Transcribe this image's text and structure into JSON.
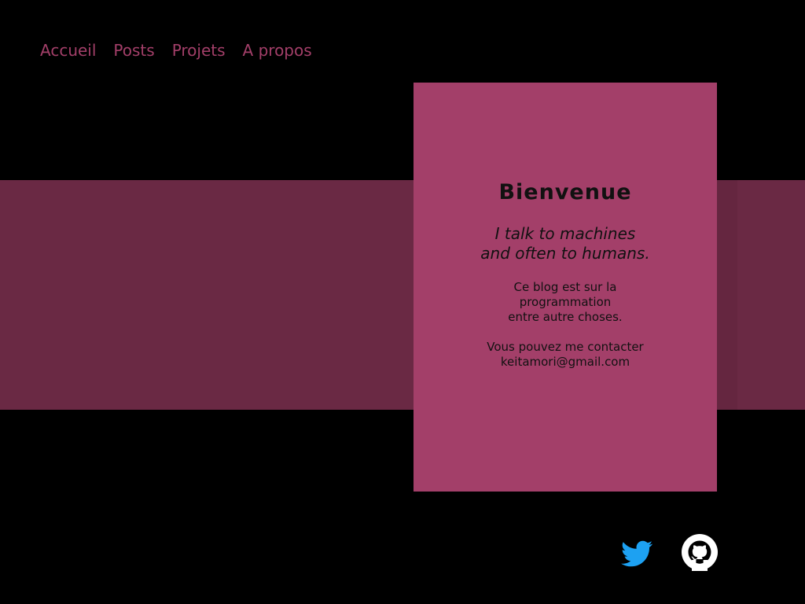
{
  "nav": {
    "items": [
      {
        "label": "Accueil"
      },
      {
        "label": "Posts"
      },
      {
        "label": "Projets"
      },
      {
        "label": "A propos"
      }
    ]
  },
  "hero": {
    "title": "Bienvenue",
    "tagline_line1": "I talk to machines",
    "tagline_line2": "and often to humans.",
    "desc_line1": "Ce blog est sur la",
    "desc_line2": "programmation",
    "desc_line3": "entre autre choses.",
    "contact_line1": "Vous pouvez me contacter",
    "contact_email": "keitamori@gmail.com"
  },
  "social": {
    "icons": [
      "twitter-icon",
      "github-icon"
    ]
  },
  "colors": {
    "background": "#000000",
    "accent": "#a33f69",
    "band": "#6a2944",
    "twitter": "#1da1f2"
  }
}
